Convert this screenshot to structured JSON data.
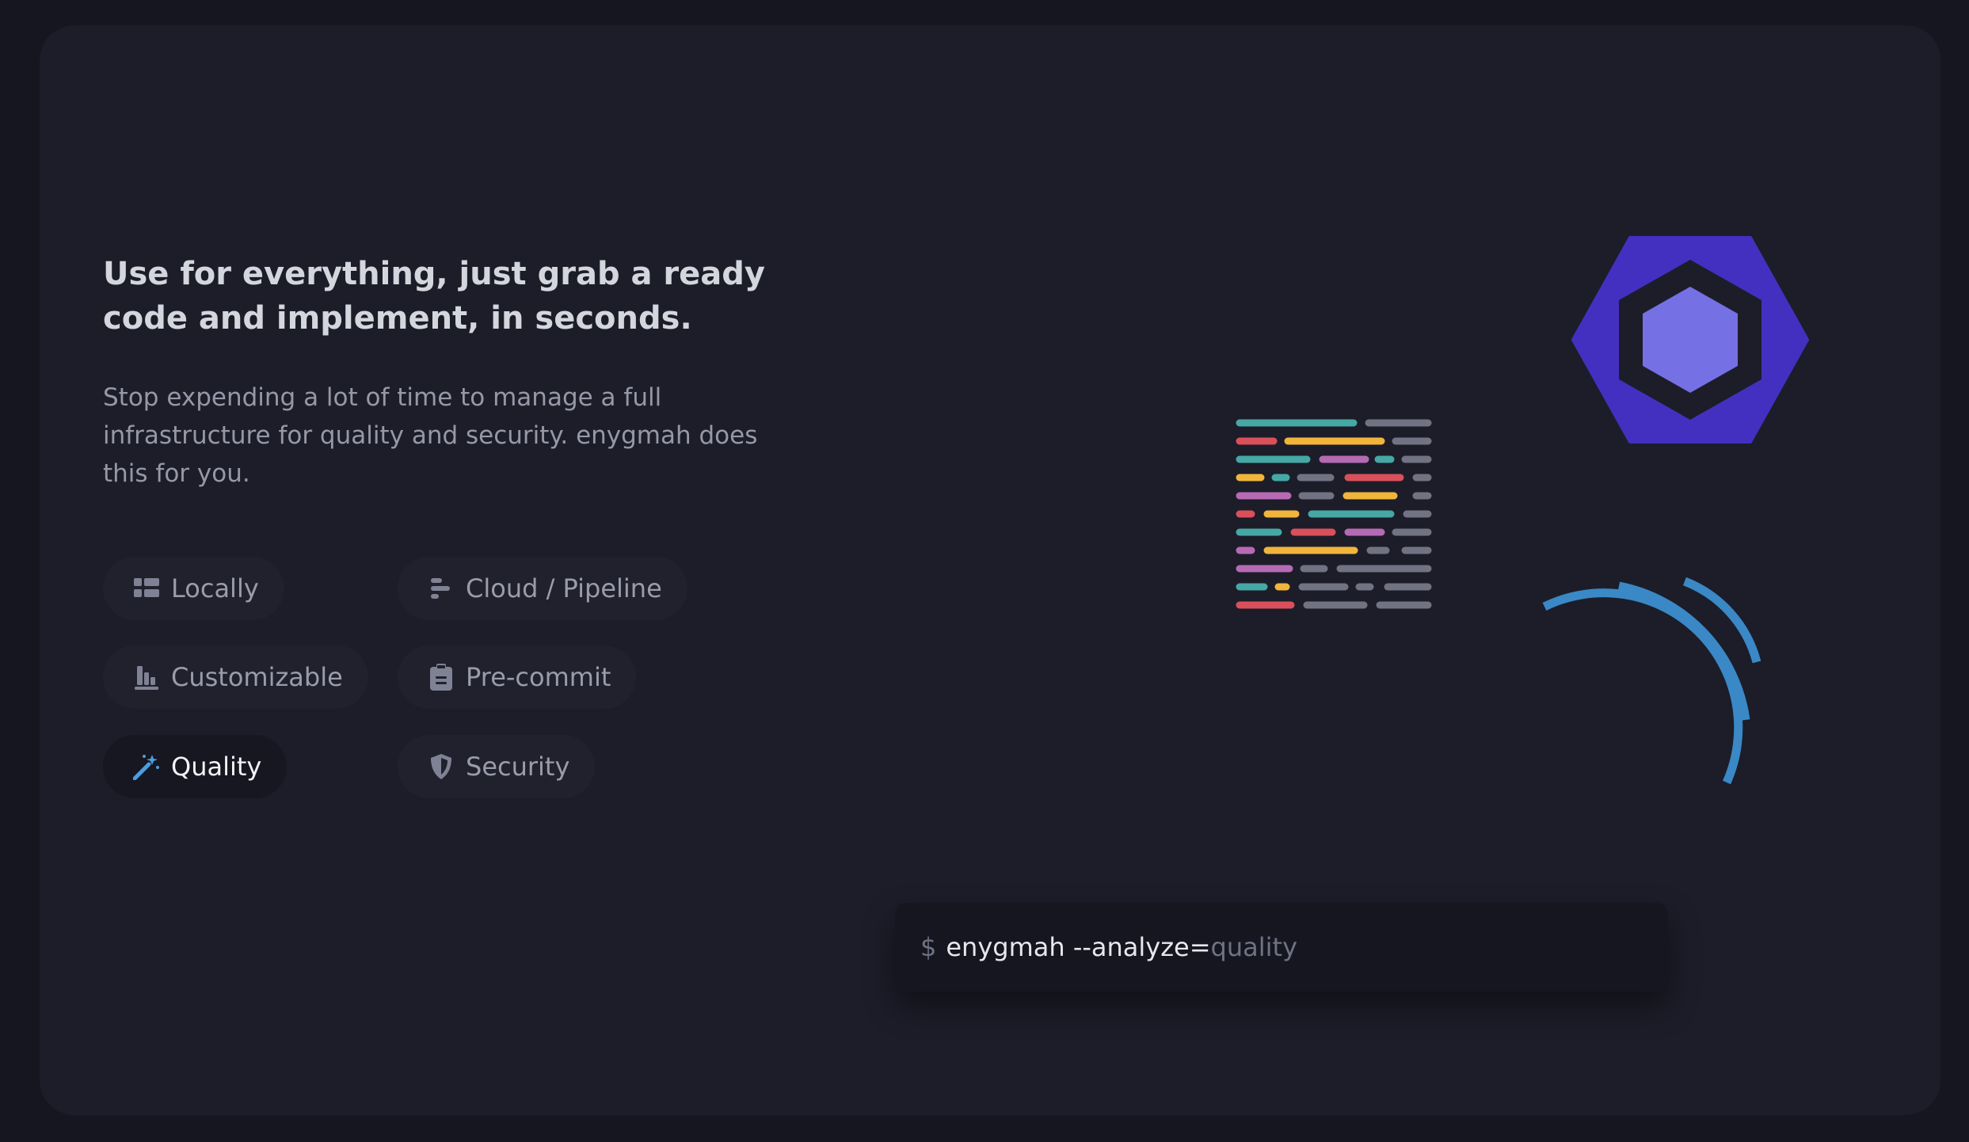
{
  "hero": {
    "headline": "Use for everything, just grab a ready code and implement, in seconds.",
    "description": "Stop expending a lot of time to manage a full infrastructure for quality and security. enygmah does this for you."
  },
  "features": [
    {
      "label": "Locally",
      "icon": "grid-icon",
      "active": false
    },
    {
      "label": "Cloud / Pipeline",
      "icon": "bars-icon",
      "active": false
    },
    {
      "label": "Customizable",
      "icon": "bar-chart-icon",
      "active": false
    },
    {
      "label": "Pre-commit",
      "icon": "clipboard-icon",
      "active": false
    },
    {
      "label": "Quality",
      "icon": "magic-wand-icon",
      "active": true
    },
    {
      "label": "Security",
      "icon": "shield-icon",
      "active": false
    }
  ],
  "terminal": {
    "prompt": "$",
    "command": "enygmah --analyze=",
    "argument": "quality"
  },
  "colors": {
    "accent_blue": "#3a88c6",
    "hex_outer": "#4330c0",
    "hex_inner": "#7570e4",
    "code_teal": "#45a8a4",
    "code_red": "#d9505a",
    "code_yellow": "#f1b53c",
    "code_purple": "#b66ab4",
    "code_gray": "#717382"
  }
}
